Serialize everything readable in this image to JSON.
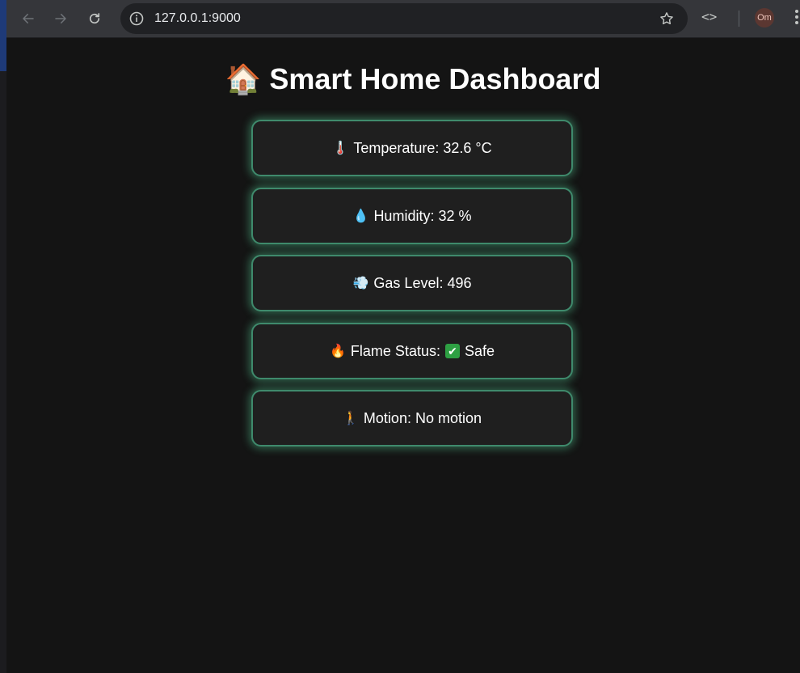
{
  "browser": {
    "url": "127.0.0.1:9000",
    "profile_initials": "Om",
    "code_label": "<>"
  },
  "page": {
    "title_icon": "🏠",
    "title": "Smart Home Dashboard"
  },
  "cards": [
    {
      "icon": "🌡️",
      "icon_name": "thermometer-icon",
      "label": "Temperature: 32.6 °C"
    },
    {
      "icon": "💧",
      "icon_name": "water-drop-icon",
      "label": "Humidity: 32 %"
    },
    {
      "icon": "💨",
      "icon_name": "gas-icon",
      "label": "Gas Level: 496"
    },
    {
      "icon": "🔥",
      "icon_name": "flame-icon",
      "label_prefix": "Flame Status:",
      "status_icon": "✔",
      "status_icon_name": "check-icon",
      "status": "Safe"
    },
    {
      "icon": "🚶",
      "icon_name": "person-walking-icon",
      "label": "Motion: No motion"
    }
  ],
  "colors": {
    "background": "#141414",
    "card_background": "#1f1f1f",
    "card_glow": "#3f8a6c",
    "safe_check": "#2ea043"
  }
}
